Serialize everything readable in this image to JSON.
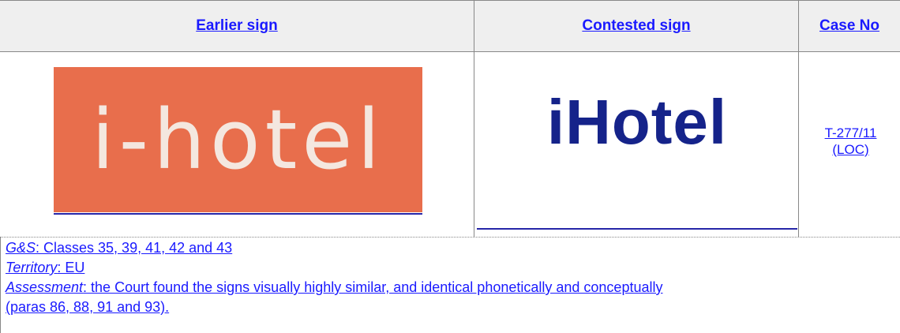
{
  "header": {
    "col1": "Earlier sign",
    "col2": "Contested sign",
    "col3": "Case No"
  },
  "row": {
    "earlier_logo_text": "i-hotel",
    "contested_logo_text": "iHotel",
    "case_line1": "T-277/11",
    "case_line2": "(LOC)"
  },
  "notes": {
    "gs_label": "G&S",
    "gs_text": ": Classes 35, 39, 41, 42 and 43",
    "territory_label": "Territory",
    "territory_text": ": EU",
    "assessment_label": "Assessment",
    "assessment_text": ": the Court found the signs visually highly similar, and identical phonetically and conceptually",
    "assessment_cont": "(paras 86, 88, 91 and 93)."
  },
  "colors": {
    "link": "#1a1aff",
    "earlier_bg": "#e86e4c",
    "contested_text": "#15238a"
  }
}
